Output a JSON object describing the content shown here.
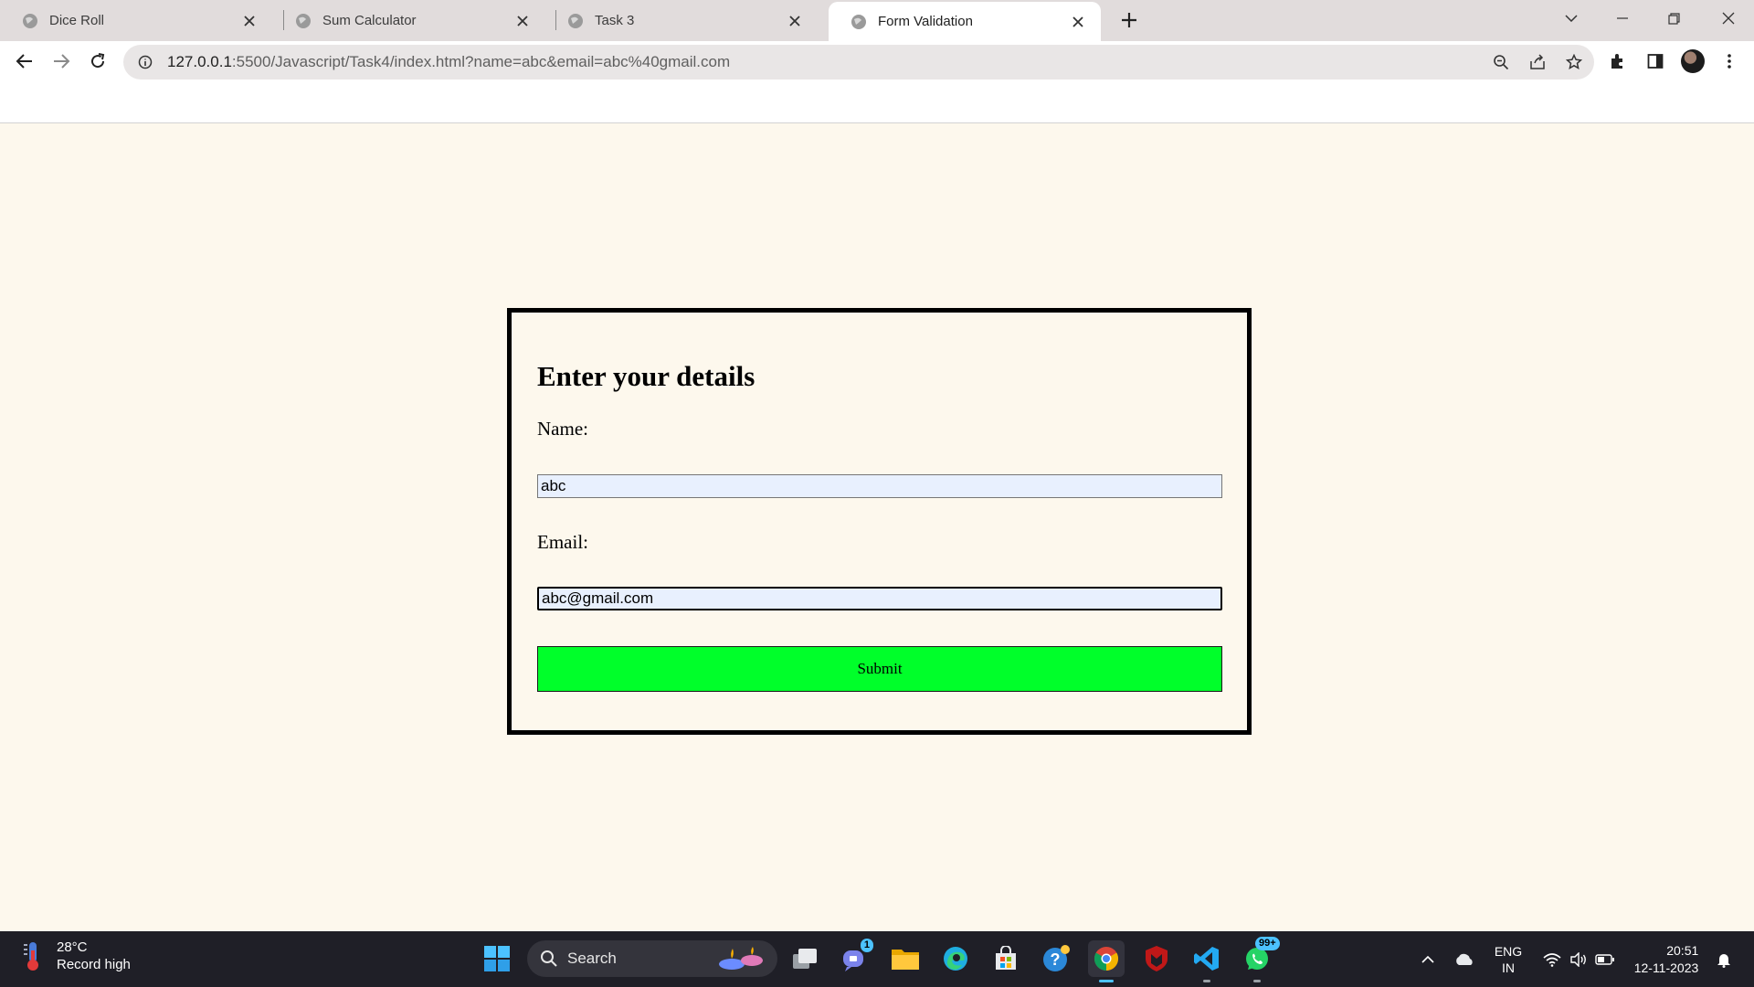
{
  "browser": {
    "tabs": [
      {
        "title": "Dice Roll"
      },
      {
        "title": "Sum Calculator"
      },
      {
        "title": "Task 3"
      },
      {
        "title": "Form Validation"
      }
    ],
    "url_host": "127.0.0.1",
    "url_rest": ":5500/Javascript/Task4/index.html?name=abc&email=abc%40gmail.com"
  },
  "form": {
    "heading": "Enter your details",
    "name_label": "Name:",
    "name_value": "abc",
    "email_label": "Email:",
    "email_value": "abc@gmail.com",
    "submit_label": "Submit"
  },
  "taskbar": {
    "weather_temp": "28°C",
    "weather_desc": "Record high",
    "search_text": "Search",
    "teams_badge": "1",
    "whatsapp_badge": "99+",
    "lang_top": "ENG",
    "lang_bottom": "IN",
    "time": "20:51",
    "date": "12-11-2023"
  },
  "colors": {
    "page_bg": "#fdf8ed",
    "submit_bg": "#00ff2a",
    "input_bg": "#e8f0fe",
    "tabstrip_bg": "#e1dcdc",
    "taskbar_bg": "#1f1f27"
  }
}
